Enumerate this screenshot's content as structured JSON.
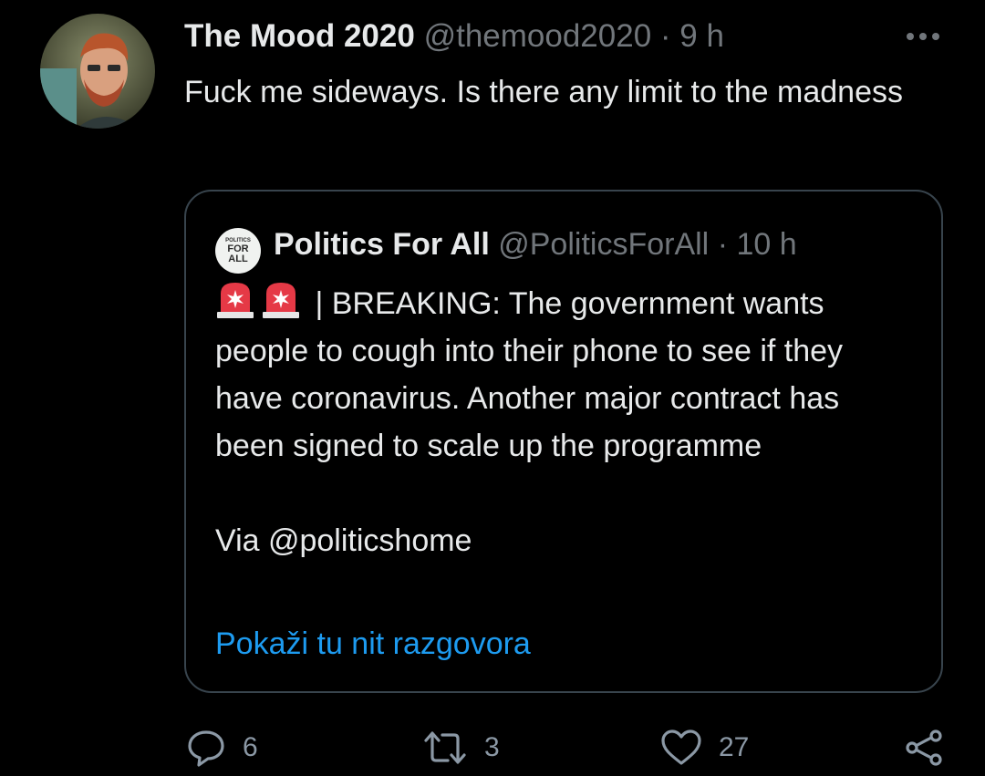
{
  "tweet": {
    "author_name": "The Mood 2020",
    "author_handle": "@themood2020",
    "separator": "·",
    "time": "9 h",
    "text": "Fuck me sideways. Is there any limit to the madness",
    "more_icon": "more-horizontal-icon"
  },
  "quoted_tweet": {
    "avatar_small": "POLITICS",
    "avatar_big_1": "FOR",
    "avatar_big_2": "ALL",
    "author_name": "Politics For All",
    "author_handle": "@PoliticsForAll",
    "separator": "·",
    "time": "10 h",
    "emoji": "🚨🚨",
    "text_line1": " | BREAKING: The government wants people to cough into their phone to see if they have coronavirus. Another major contract has been signed to scale up the programme",
    "text_via": "Via @politicshome",
    "show_thread_link": "Pokaži tu nit razgovora"
  },
  "actions": {
    "reply": {
      "icon": "reply-icon",
      "count": "6"
    },
    "retweet": {
      "icon": "retweet-icon",
      "count": "3"
    },
    "like": {
      "icon": "heart-icon",
      "count": "27"
    },
    "share": {
      "icon": "share-icon"
    }
  },
  "colors": {
    "background": "#000000",
    "text": "#e7e9ea",
    "muted": "#71767b",
    "link": "#1d9bf0",
    "border": "#38444d"
  }
}
